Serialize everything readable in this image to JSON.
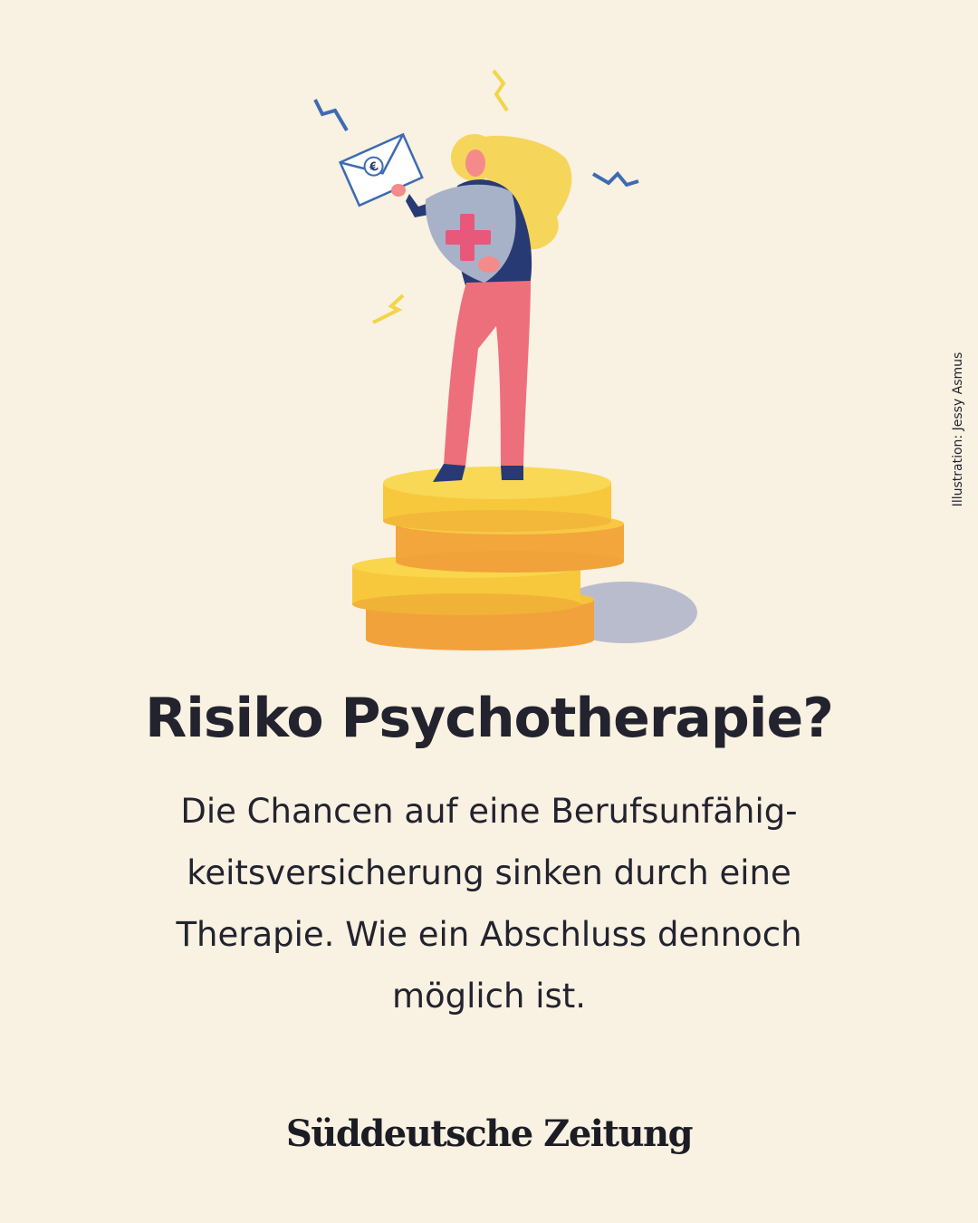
{
  "credit": "Illustration: Jessy Asmus",
  "headline": "Risiko Psychotherapie?",
  "teaser_lines": [
    "Die Chancen auf eine Berufsunfähig-",
    "keitsversicherung sinken durch eine",
    "Therapie. Wie ein Abschluss dennoch",
    "möglich ist."
  ],
  "logo": "Süddeutsche Zeitung",
  "illustration": {
    "envelope_symbol": "€",
    "icons": [
      "woman-figure-icon",
      "envelope-euro-icon",
      "health-shield-icon",
      "coin-stack-icon",
      "zigzag-spark-icon"
    ]
  },
  "colors": {
    "background": "#f9f1e1",
    "text": "#23232f",
    "coin": "#f7c83c",
    "coin_side": "#f2a23a",
    "pants": "#ee6f7c",
    "navy": "#283a73",
    "hair": "#f6d55b",
    "cross": "#e8587a",
    "spark_blue": "#3d6bb3",
    "spark_yellow": "#f2d548"
  }
}
